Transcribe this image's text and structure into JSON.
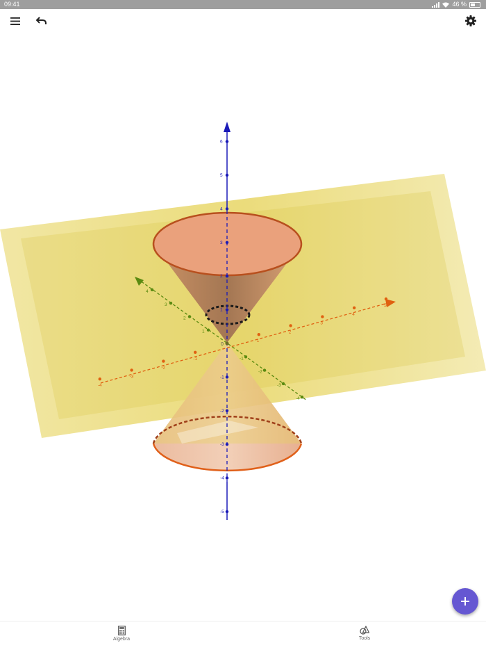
{
  "status_bar": {
    "time": "09:41",
    "battery": "46 %"
  },
  "toolbar": {
    "menu_icon": "menu-icon",
    "undo_icon": "undo-icon",
    "settings_icon": "gear-icon"
  },
  "axes": {
    "x_ticks": [
      "-4",
      "-3",
      "-2",
      "-1",
      "1",
      "2",
      "3",
      "4",
      "5"
    ],
    "y_ticks": [
      "4",
      "3",
      "2",
      "1",
      "-1",
      "-2",
      "-3",
      "-4"
    ],
    "z_ticks": [
      "6",
      "5",
      "4",
      "3",
      "2",
      "1",
      "-1",
      "-2",
      "-3",
      "-4",
      "-5"
    ],
    "origin_label": "0",
    "colors": {
      "x": "#e06010",
      "y": "#5a8a10",
      "z": "#1a1ab8",
      "cone": "#e8a07a",
      "plane": "#e6d35a"
    }
  },
  "fab": {
    "icon": "plus-icon"
  },
  "bottom_nav": {
    "items": [
      {
        "label": "Algebra",
        "icon": "calculator-icon"
      },
      {
        "label": "Tools",
        "icon": "shapes-icon"
      }
    ]
  }
}
